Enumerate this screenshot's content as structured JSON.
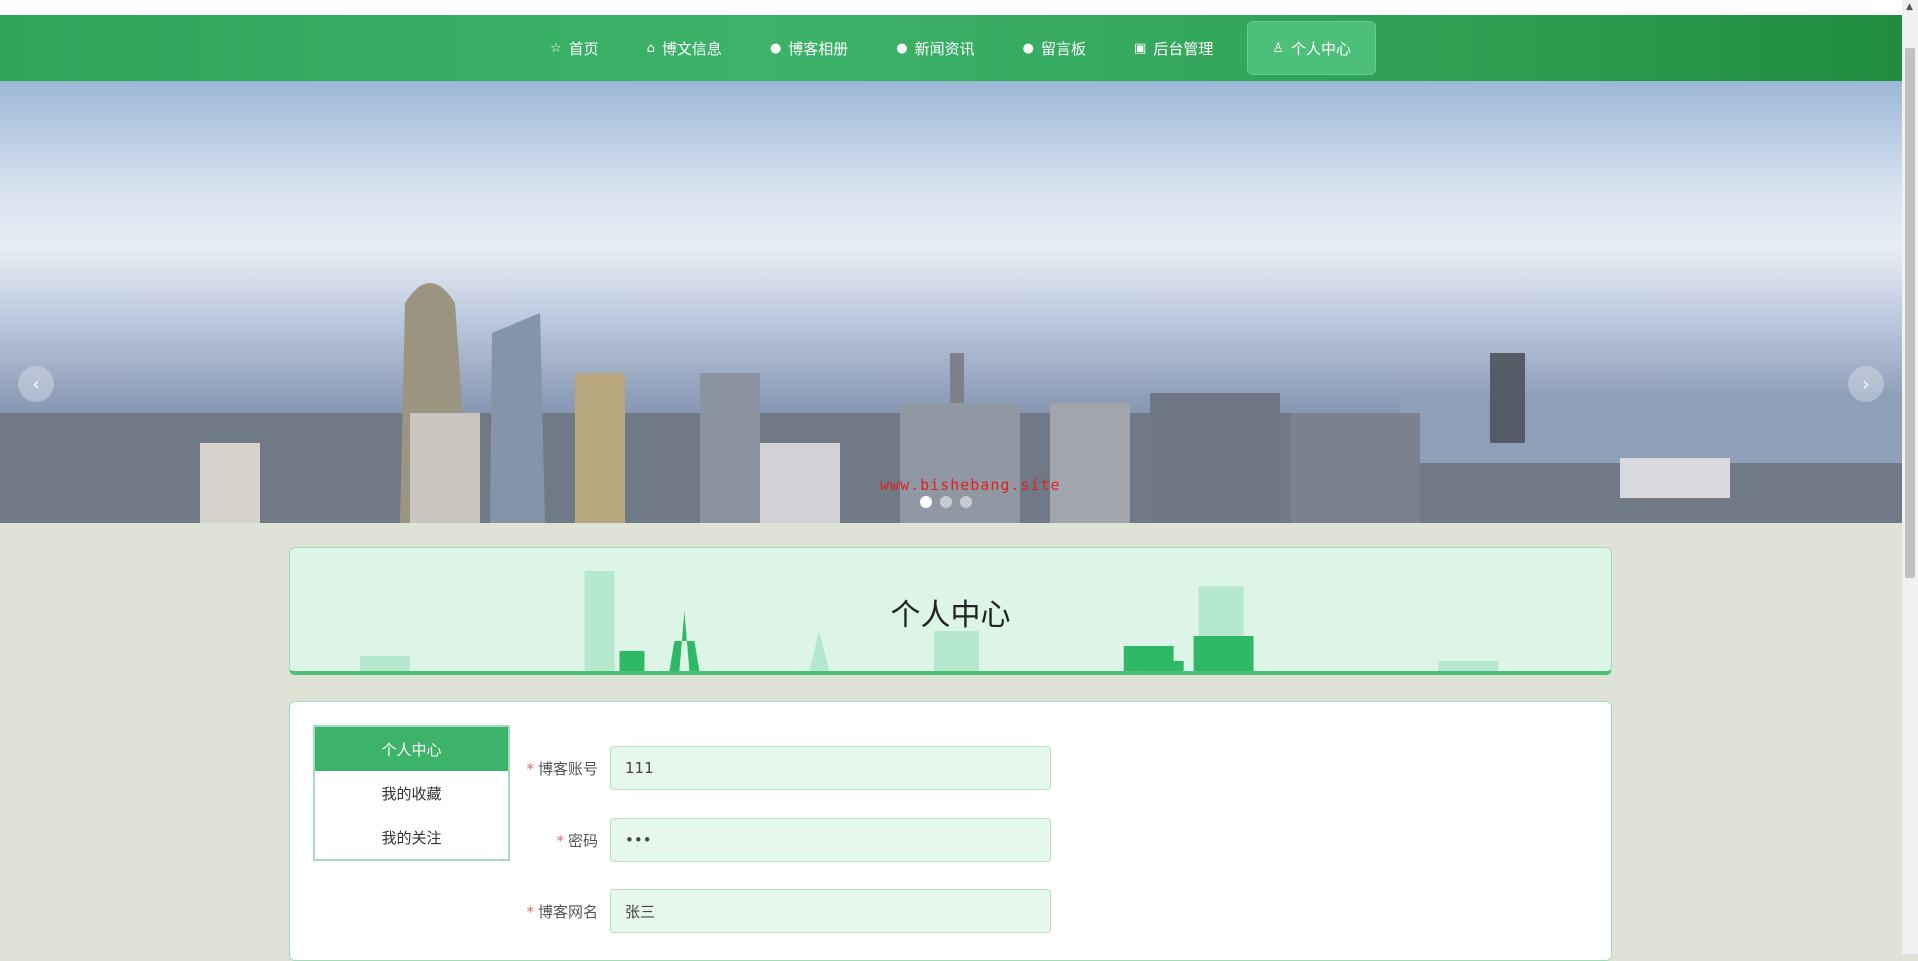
{
  "nav": {
    "items": [
      {
        "label": "首页",
        "icon": "☆"
      },
      {
        "label": "博文信息",
        "icon": "⌂"
      },
      {
        "label": "博客相册",
        "icon": "●"
      },
      {
        "label": "新闻资讯",
        "icon": "●"
      },
      {
        "label": "留言板",
        "icon": "●"
      },
      {
        "label": "后台管理",
        "icon": "▣"
      },
      {
        "label": "个人中心",
        "icon": "♙"
      }
    ],
    "active": "个人中心"
  },
  "banner": {
    "watermark": "www.bishebang.site",
    "prev": "‹",
    "next": "›",
    "slide_count": 3,
    "current_slide": 1
  },
  "page_title": "个人中心",
  "sidebar": {
    "items": [
      "个人中心",
      "我的收藏",
      "我的关注"
    ],
    "active": "个人中心"
  },
  "form": {
    "fields": [
      {
        "label": "博客账号",
        "value": "111",
        "required": "*"
      },
      {
        "label": "密码",
        "value": "•••",
        "required": "*"
      },
      {
        "label": "博客网名",
        "value": "张三",
        "required": "*"
      }
    ]
  },
  "colors": {
    "primary": "#3db36a",
    "input_bg": "#e6f7ec"
  }
}
